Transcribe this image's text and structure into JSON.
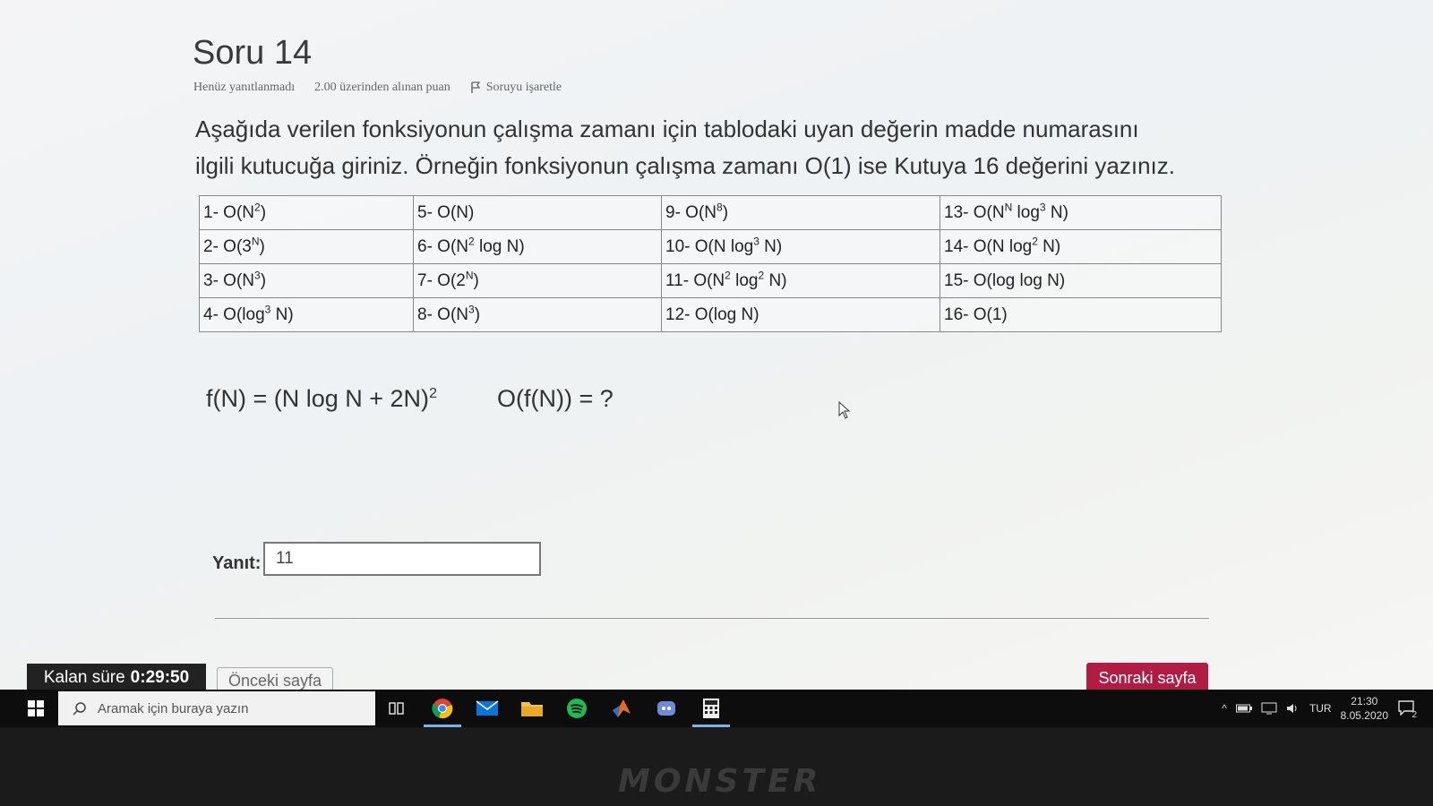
{
  "question": {
    "title": "Soru 14",
    "status": "Henüz yanıtlanmadı",
    "points": "2.00 üzerinden alınan puan",
    "flag_label": "Soruyu işaretle",
    "text_line1": "Aşağıda verilen fonksiyonun çalışma zamanı için tablodaki uyan değerin madde numarasını",
    "text_line2": "ilgili kutucuğa giriniz. Örneğin fonksiyonun çalışma zamanı O(1) ise Kutuya 16 değerini yazınız."
  },
  "options": [
    {
      "base": "1- O(N",
      "sup": "2",
      "tail": ")"
    },
    {
      "base": "5- O(N)",
      "sup": "",
      "tail": ""
    },
    {
      "base": "9- O(N",
      "sup": "8",
      "tail": ")"
    },
    {
      "base": "13- O(N",
      "sup": "N",
      "mid": " log",
      "sup2": "3",
      "tail": " N)"
    },
    {
      "base": "2- O(3",
      "sup": "N",
      "tail": ")"
    },
    {
      "base": "6- O(N",
      "sup": "2",
      "tail": " log N)"
    },
    {
      "base": "10- O(N log",
      "sup": "3",
      "tail": " N)"
    },
    {
      "base": "14- O(N log",
      "sup": "2",
      "tail": " N)"
    },
    {
      "base": "3- O(N",
      "sup": "3",
      "tail": ")"
    },
    {
      "base": "7- O(2",
      "sup": "N",
      "tail": ")"
    },
    {
      "base": "11- O(N",
      "sup": "2",
      "mid": " log",
      "sup2": "2",
      "tail": " N)"
    },
    {
      "base": "15- O(log log N)",
      "sup": "",
      "tail": ""
    },
    {
      "base": "4- O(log",
      "sup": "3",
      "tail": " N)"
    },
    {
      "base": "8- O(N",
      "sup": "3",
      "tail": ")"
    },
    {
      "base": "12- O(log N)",
      "sup": "",
      "tail": ""
    },
    {
      "base": "16- O(1)",
      "sup": "",
      "tail": ""
    }
  ],
  "formula": {
    "lhs": "f(N) = (N log N + 2N)",
    "exp": "2",
    "rhs": "O(f(N)) = ?"
  },
  "answer": {
    "label": "Yanıt:",
    "value": "11"
  },
  "timer": {
    "label": "Kalan süre",
    "value": "0:29:50"
  },
  "nav": {
    "prev_label": "Önceki sayfa",
    "next_label": "Sonraki sayfa"
  },
  "taskbar": {
    "search_placeholder": "Aramak için buraya yazın",
    "language": "TUR",
    "time": "21:30",
    "date": "8.05.2020",
    "notification_count": "2",
    "icons": [
      "task-view-icon",
      "chrome-icon",
      "mail-icon",
      "file-explorer-icon",
      "spotify-icon",
      "matlab-icon",
      "discord-icon",
      "calculator-icon"
    ]
  },
  "bezel": {
    "brand": "MONSTER"
  }
}
